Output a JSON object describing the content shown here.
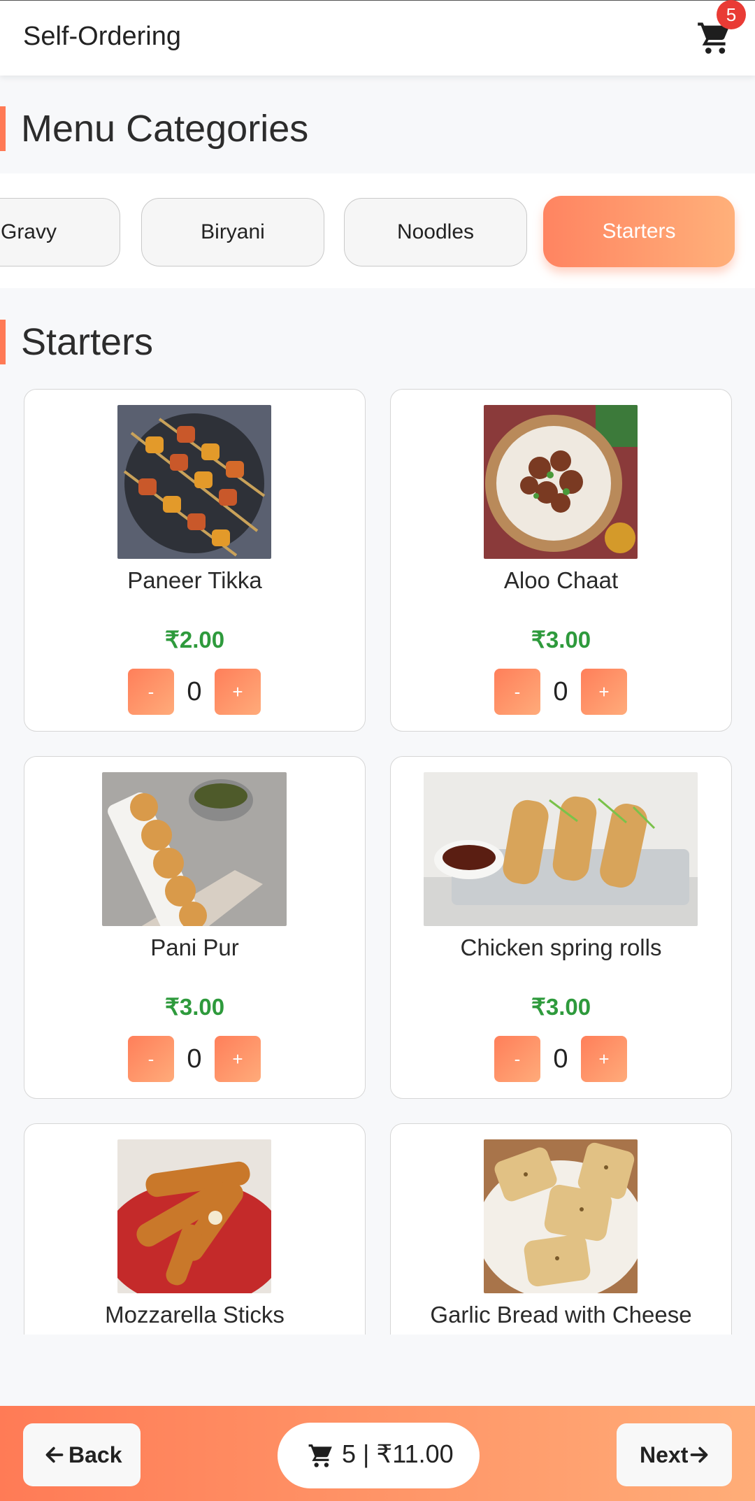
{
  "header": {
    "title": "Self-Ordering",
    "cart_icon": "cart-icon",
    "cart_count": "5"
  },
  "categories": {
    "heading": "Menu Categories",
    "items": [
      "Gravy",
      "Biryani",
      "Noodles",
      "Starters"
    ],
    "selected": "Starters"
  },
  "section": {
    "heading": "Starters"
  },
  "items": [
    {
      "name": "Paneer Tikka",
      "price": "₹2.00",
      "qty": "0",
      "minus": "-",
      "plus": "+"
    },
    {
      "name": "Aloo Chaat",
      "price": "₹3.00",
      "qty": "0",
      "minus": "-",
      "plus": "+"
    },
    {
      "name": "Pani Pur",
      "price": "₹3.00",
      "qty": "0",
      "minus": "-",
      "plus": "+"
    },
    {
      "name": "Chicken spring rolls",
      "price": "₹3.00",
      "qty": "0",
      "minus": "-",
      "plus": "+"
    },
    {
      "name": "Mozzarella Sticks"
    },
    {
      "name": "Garlic Bread with Cheese"
    }
  ],
  "footer": {
    "back_label": "Back",
    "next_label": "Next",
    "summary": "5 | ₹11.00",
    "back_icon": "arrow-left-icon",
    "next_icon": "arrow-right-icon"
  },
  "colors": {
    "accent": "#ff7f5a",
    "price": "#2e9a3c",
    "badge": "#e93b35"
  }
}
